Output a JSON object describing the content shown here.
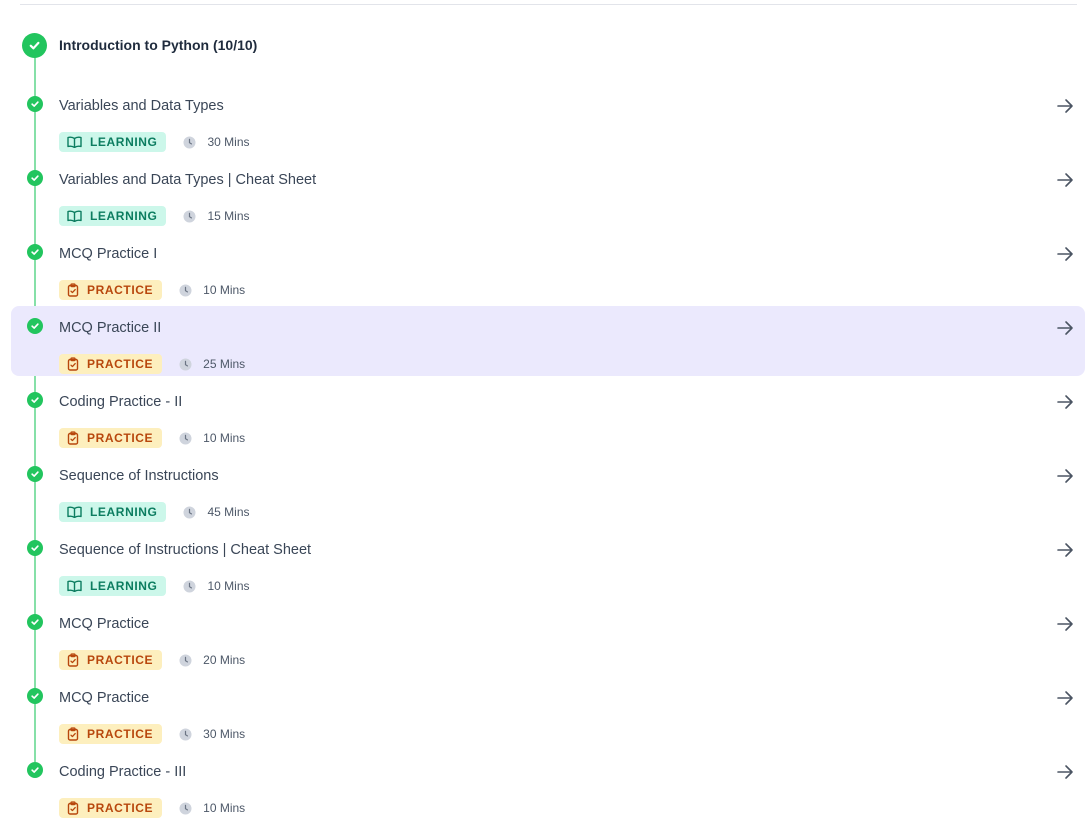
{
  "section": {
    "title": "Introduction to Python (10/10)",
    "status_icon": "check-circle-icon",
    "accent_color": "#22c55e"
  },
  "badge_types": {
    "learning": {
      "label": "LEARNING",
      "icon": "book-icon",
      "bg": "#ccf7ea",
      "fg": "#0c7d60"
    },
    "practice": {
      "label": "PRACTICE",
      "icon": "clipboard-icon",
      "bg": "#fdefbe",
      "fg": "#b8470d"
    }
  },
  "highlight_color": "#ebe9fd",
  "modules": [
    {
      "title": "Variables and Data Types",
      "type": "learning",
      "badge": "LEARNING",
      "duration": "30 Mins",
      "completed": true,
      "highlighted": false
    },
    {
      "title": "Variables and Data Types | Cheat Sheet",
      "type": "learning",
      "badge": "LEARNING",
      "duration": "15 Mins",
      "completed": true,
      "highlighted": false
    },
    {
      "title": "MCQ Practice I",
      "type": "practice",
      "badge": "PRACTICE",
      "duration": "10 Mins",
      "completed": true,
      "highlighted": false
    },
    {
      "title": "MCQ Practice II",
      "type": "practice",
      "badge": "PRACTICE",
      "duration": "25 Mins",
      "completed": true,
      "highlighted": true
    },
    {
      "title": "Coding Practice - II",
      "type": "practice",
      "badge": "PRACTICE",
      "duration": "10 Mins",
      "completed": true,
      "highlighted": false
    },
    {
      "title": "Sequence of Instructions",
      "type": "learning",
      "badge": "LEARNING",
      "duration": "45 Mins",
      "completed": true,
      "highlighted": false
    },
    {
      "title": "Sequence of Instructions | Cheat Sheet",
      "type": "learning",
      "badge": "LEARNING",
      "duration": "10 Mins",
      "completed": true,
      "highlighted": false
    },
    {
      "title": "MCQ Practice",
      "type": "practice",
      "badge": "PRACTICE",
      "duration": "20 Mins",
      "completed": true,
      "highlighted": false
    },
    {
      "title": "MCQ Practice",
      "type": "practice",
      "badge": "PRACTICE",
      "duration": "30 Mins",
      "completed": true,
      "highlighted": false
    },
    {
      "title": "Coding Practice - III",
      "type": "practice",
      "badge": "PRACTICE",
      "duration": "10 Mins",
      "completed": true,
      "highlighted": false
    }
  ]
}
